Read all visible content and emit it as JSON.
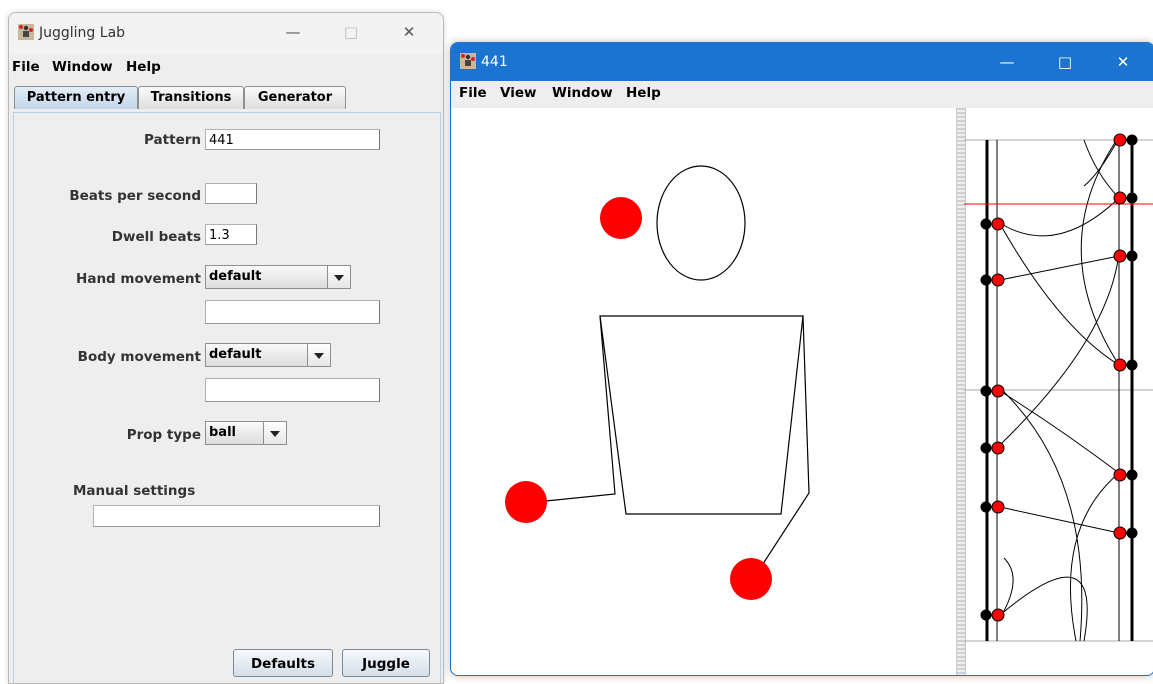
{
  "window_main": {
    "title": "Juggling Lab",
    "menu": [
      "File",
      "Window",
      "Help"
    ],
    "tabs": [
      "Pattern entry",
      "Transitions",
      "Generator"
    ],
    "selected_tab": "Pattern entry",
    "form": {
      "pattern_label": "Pattern",
      "pattern_value": "441",
      "bps_label": "Beats per second",
      "bps_value": "",
      "dwell_label": "Dwell beats",
      "dwell_value": "1.3",
      "hand_label": "Hand movement",
      "hand_value": "default",
      "hand_custom": "",
      "body_label": "Body movement",
      "body_value": "default",
      "body_custom": "",
      "prop_label": "Prop type",
      "prop_value": "ball",
      "manual_label": "Manual settings",
      "manual_value": ""
    },
    "buttons": {
      "defaults": "Defaults",
      "juggle": "Juggle"
    }
  },
  "window_anim": {
    "title": "441",
    "menu": [
      "File",
      "View",
      "Window",
      "Help"
    ]
  },
  "colors": {
    "ball": "#ff0000",
    "titlebar_active": "#1b75d0",
    "tab_selected": "#c2d6ea",
    "current_time_line": "#ff0000"
  },
  "icons": {
    "app": "juggler-icon",
    "minimize": "minimize-icon",
    "maximize": "maximize-icon",
    "close": "close-icon",
    "dropdown": "chevron-down-icon"
  }
}
